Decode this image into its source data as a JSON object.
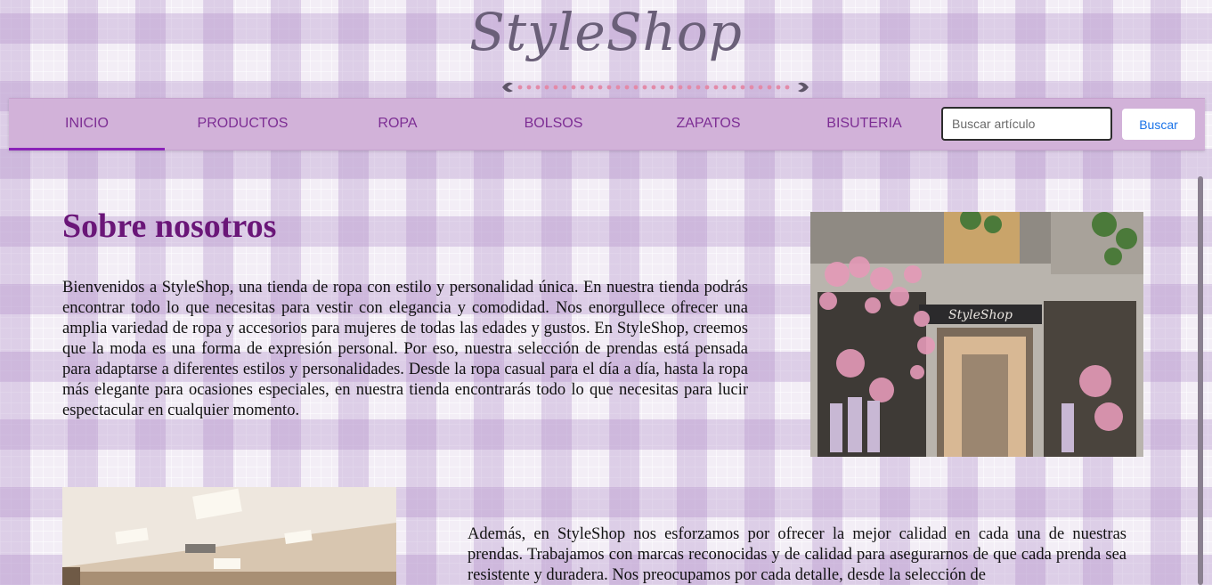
{
  "header": {
    "logo_text": "StyleShop"
  },
  "nav": {
    "items": [
      {
        "label": "INICIO",
        "active": true
      },
      {
        "label": "PRODUCTOS",
        "active": false
      },
      {
        "label": "ROPA",
        "active": false
      },
      {
        "label": "BOLSOS",
        "active": false
      },
      {
        "label": "ZAPATOS",
        "active": false
      },
      {
        "label": "BISUTERIA",
        "active": false
      }
    ],
    "search": {
      "placeholder": "Buscar artículo",
      "value": "",
      "button_label": "Buscar"
    }
  },
  "main": {
    "title": "Sobre nosotros",
    "about_paragraph": "Bienvenidos a StyleShop, una tienda de ropa con estilo y personalidad única. En nuestra tienda podrás encontrar todo lo que necesitas para vestir con elegancia y comodidad. Nos enorgullece ofrecer una amplia variedad de ropa y accesorios para mujeres de todas las edades y gustos. En StyleShop, creemos que la moda es una forma de expresión personal. Por eso, nuestra selección de prendas está pensada para adaptarse a diferentes estilos y personalidades. Desde la ropa casual para el día a día, hasta la ropa más elegante para ocasiones especiales, en nuestra tienda encontrarás todo lo que necesitas para lucir espectacular en cualquier momento.",
    "store_sign": "StyleShop",
    "quality_paragraph": "Además, en StyleShop nos esforzamos por ofrecer la mejor calidad en cada una de nuestras prendas. Trabajamos con marcas reconocidas y de calidad para asegurarnos de que cada prenda sea resistente y duradera. Nos preocupamos por cada detalle, desde la selección de"
  },
  "colors": {
    "nav_background": "#d2b2d9",
    "nav_text": "#7d2e94",
    "active_underline": "#8b22b8",
    "title": "#6a1678",
    "search_button_text": "#1a73e8"
  }
}
